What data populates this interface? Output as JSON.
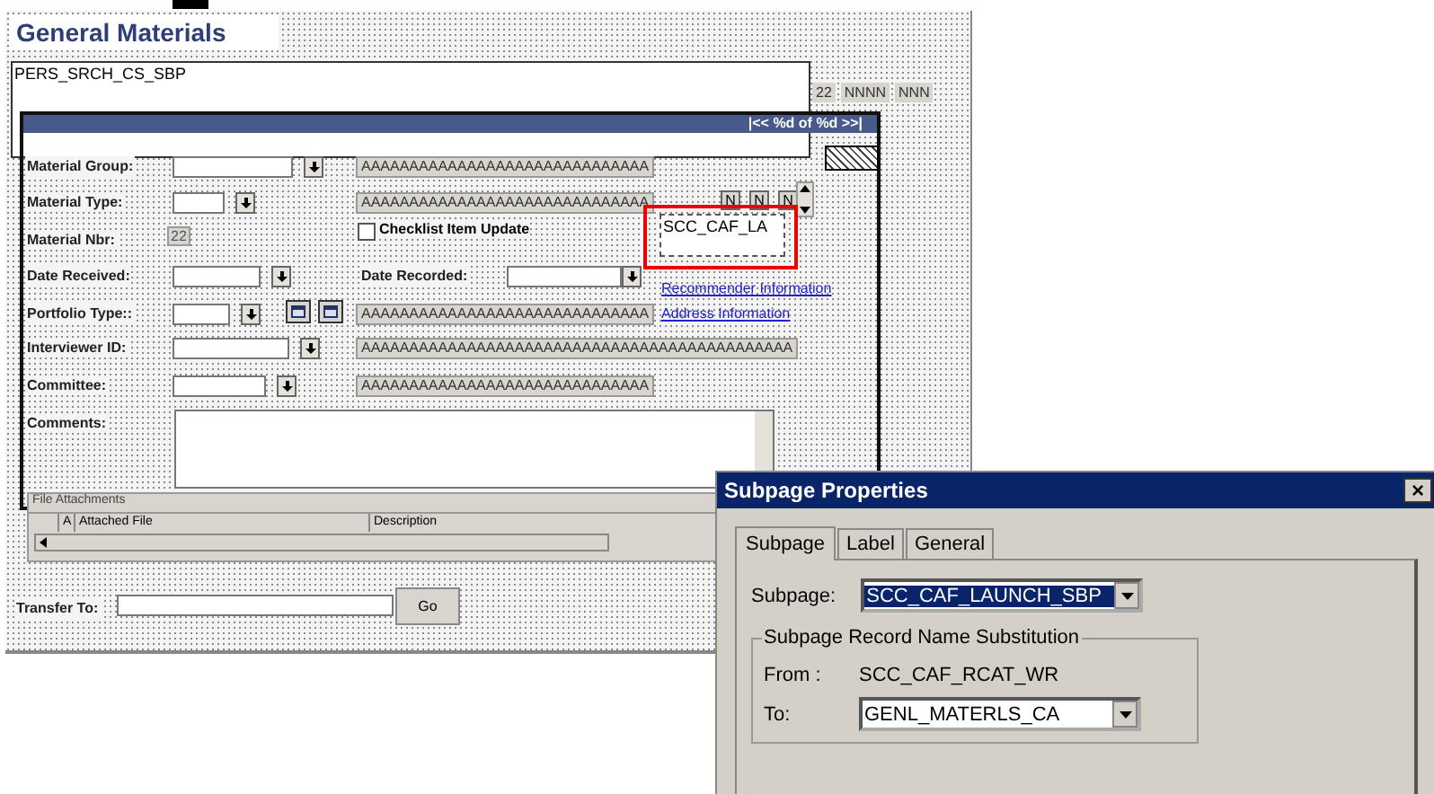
{
  "page": {
    "title": "General Materials"
  },
  "search_subpage": {
    "name": "PERS_SRCH_CS_SBP"
  },
  "header_fields": [
    "22",
    "NNNN",
    "NNN"
  ],
  "scroll_area": {
    "navigation": "|<< %d of %d >>|"
  },
  "fields": [
    {
      "kind": "dropdown",
      "label": "Material Group:",
      "description": "AAAAAAAAAAAAAAAAAAAAAAAAAAAAAA"
    },
    {
      "kind": "dropdown",
      "label": "Material Type:",
      "description": "AAAAAAAAAAAAAAAAAAAAAAAAAAAAAA",
      "codes": [
        "N",
        "N",
        "N"
      ]
    },
    {
      "kind": "number",
      "label": "Material Nbr:",
      "value": "22"
    },
    {
      "kind": "dropdown",
      "label": "Date Received:"
    },
    {
      "kind": "dropdown",
      "label": "Portfolio Type::",
      "description": "AAAAAAAAAAAAAAAAAAAAAAAAAAAAAA"
    },
    {
      "kind": "dropdown",
      "label": "Interviewer ID:",
      "description": "AAAAAAAAAAAAAAAAAAAAAAAAAAAAAAAAAAAAAAAAAAAAA"
    },
    {
      "kind": "dropdown",
      "label": "Committee:",
      "description": "AAAAAAAAAAAAAAAAAAAAAAAAAAAAAA"
    },
    {
      "kind": "textarea",
      "label": "Comments:"
    }
  ],
  "checkbox": {
    "label": "Checklist Item Update",
    "checked": false
  },
  "date_recorded": {
    "label": "Date Recorded:"
  },
  "subpage_field": {
    "value": "SCC_CAF_LA",
    "selected": true
  },
  "links": [
    "Recommender Information",
    "Address Information"
  ],
  "grid": {
    "title": "File Attachments",
    "columns": [
      "A",
      "Attached File",
      "Description"
    ]
  },
  "transfer": {
    "label": "Transfer To:",
    "button": "Go"
  },
  "dialog": {
    "title": "Subpage Properties",
    "close": "×",
    "tabs": [
      {
        "label": "Subpage",
        "selected": true
      },
      {
        "label": "Label",
        "selected": false
      },
      {
        "label": "General",
        "selected": false
      }
    ],
    "subpage_label": "Subpage:",
    "subpage_value": "SCC_CAF_LAUNCH_SBP",
    "subpage_highlighted": true,
    "group_title": "Subpage Record Name Substitution",
    "from_label": "From :",
    "from_value": "SCC_CAF_RCAT_WR",
    "to_label": "To:",
    "to_value": "GENL_MATERLS_CA"
  }
}
